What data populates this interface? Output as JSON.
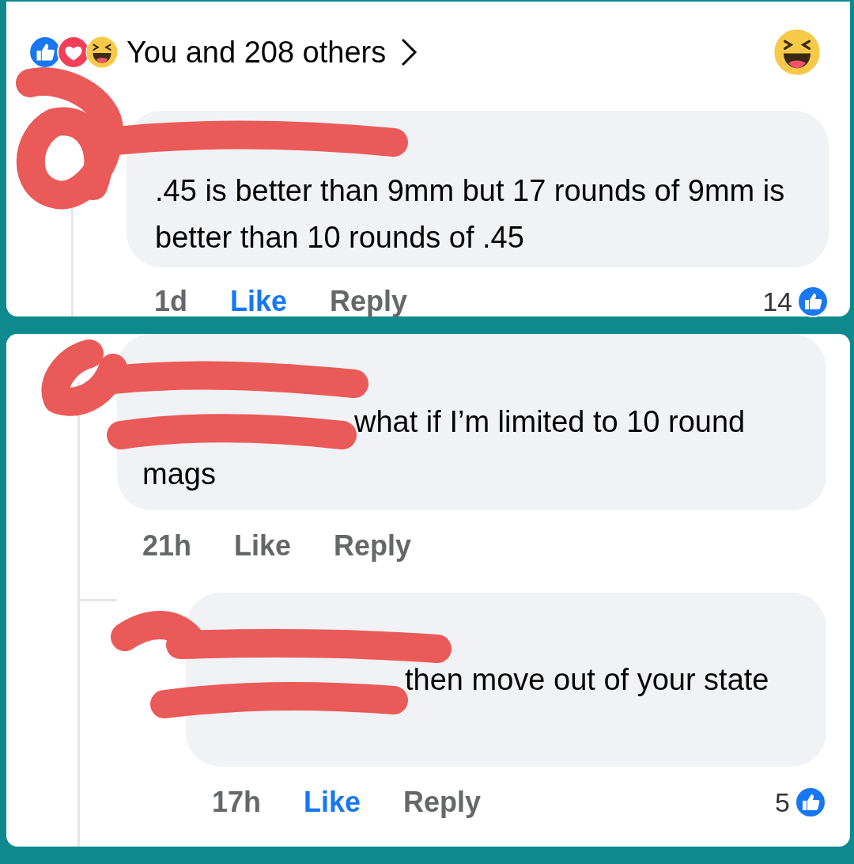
{
  "reactions_summary": {
    "text": "You and 208 others"
  },
  "panels": [
    {
      "comments": [
        {
          "text": ".45 is better than 9mm but 17 rounds of 9mm is better than 10 rounds of .45",
          "time": "1d",
          "like_label": "Like",
          "reply_label": "Reply",
          "liked": true,
          "reaction_count": "14"
        }
      ]
    },
    {
      "comments": [
        {
          "text": "what if I’m limited to 10 round mags",
          "time": "21h",
          "like_label": "Like",
          "reply_label": "Reply",
          "liked": false,
          "children": [
            {
              "text": "then move out of your state",
              "time": "17h",
              "like_label": "Like",
              "reply_label": "Reply",
              "liked": true,
              "reaction_count": "5"
            }
          ]
        }
      ]
    }
  ]
}
